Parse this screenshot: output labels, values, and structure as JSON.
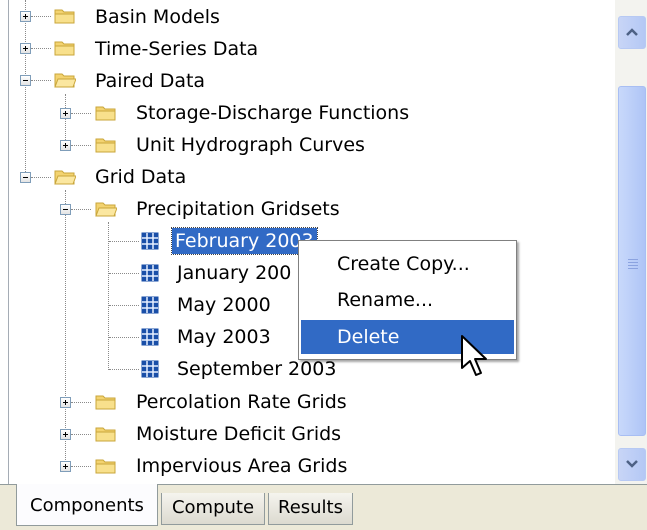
{
  "tree": {
    "items": [
      {
        "label": "Basin Models",
        "expanded": false
      },
      {
        "label": "Time-Series Data",
        "expanded": false
      },
      {
        "label": "Paired Data",
        "expanded": true
      },
      {
        "label": "Storage-Discharge Functions",
        "expanded": false
      },
      {
        "label": "Unit Hydrograph Curves",
        "expanded": false
      },
      {
        "label": "Grid Data",
        "expanded": true
      },
      {
        "label": "Precipitation Gridsets",
        "expanded": true
      },
      {
        "label": "February 2003",
        "selected": true
      },
      {
        "label": "January 200"
      },
      {
        "label": "May 2000"
      },
      {
        "label": "May 2003"
      },
      {
        "label": "September 2003"
      },
      {
        "label": "Percolation Rate Grids",
        "expanded": false
      },
      {
        "label": "Moisture Deficit Grids",
        "expanded": false
      },
      {
        "label": "Impervious Area Grids",
        "expanded": false
      }
    ]
  },
  "context_menu": {
    "items": [
      {
        "label": "Create Copy..."
      },
      {
        "label": "Rename..."
      },
      {
        "label": "Delete",
        "highlighted": true
      }
    ]
  },
  "tabs": [
    {
      "label": "Components",
      "active": true
    },
    {
      "label": "Compute",
      "active": false
    },
    {
      "label": "Results",
      "active": false
    }
  ],
  "colors": {
    "selection": "#316ac5",
    "folder": "#f3d370",
    "scrollbar": "#b9cdf8"
  }
}
